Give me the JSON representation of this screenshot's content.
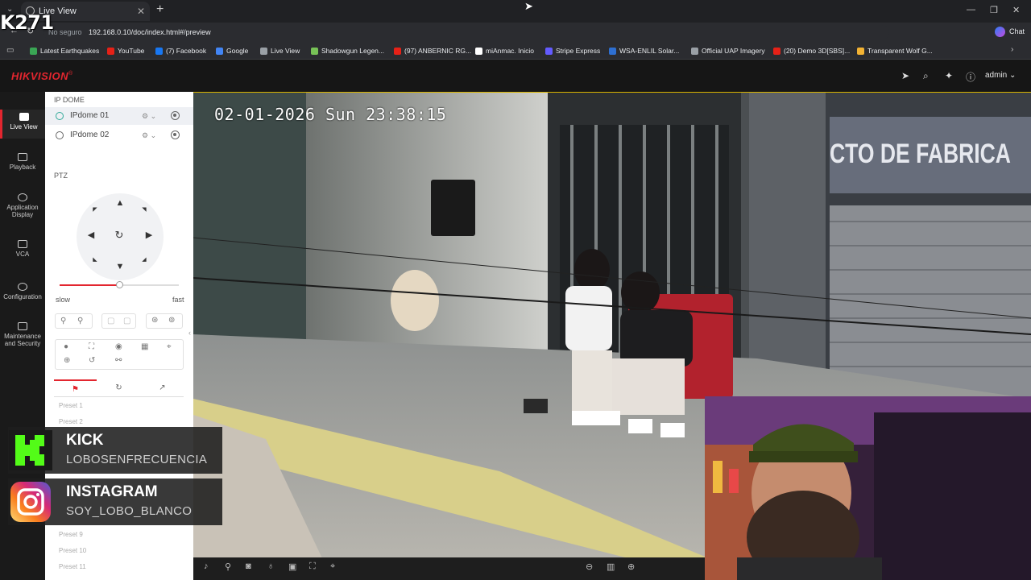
{
  "browser": {
    "tab_title": "Live View",
    "url_security": "No seguro",
    "url": "192.168.0.10/doc/index.html#/preview",
    "chat_label": "Chat",
    "bookmarks": [
      {
        "label": "Latest Earthquakes",
        "icon": "earthquake-icon",
        "color": "#3aa655"
      },
      {
        "label": "YouTube",
        "icon": "youtube-icon",
        "color": "#e62117"
      },
      {
        "label": "(7) Facebook",
        "icon": "facebook-icon",
        "color": "#1877f2"
      },
      {
        "label": "Google",
        "icon": "google-icon",
        "color": "#4285f4"
      },
      {
        "label": "Live View",
        "icon": "globe-icon",
        "color": "#9aa0a6"
      },
      {
        "label": "Shadowgun Legen...",
        "icon": "android-icon",
        "color": "#78c257"
      },
      {
        "label": "(97) ANBERNIC RG...",
        "icon": "youtube-icon",
        "color": "#e62117"
      },
      {
        "label": "miAnmac. Inicio",
        "icon": "r-icon",
        "color": "#ffffff"
      },
      {
        "label": "Stripe Express",
        "icon": "stripe-icon",
        "color": "#635bff"
      },
      {
        "label": "WSA-ENLIL Solar...",
        "icon": "noaa-icon",
        "color": "#2e6fd1"
      },
      {
        "label": "Official UAP Imagery",
        "icon": "globe-icon",
        "color": "#9aa0a6"
      },
      {
        "label": "(20) Demo 3D[SBS]...",
        "icon": "youtube-icon",
        "color": "#e62117"
      },
      {
        "label": "Transparent Wolf G...",
        "icon": "document-icon",
        "color": "#f2b233"
      }
    ]
  },
  "app": {
    "brand": "HIKVISION",
    "user": "admin",
    "nav": [
      {
        "label": "Live View",
        "icon": "live-view-icon"
      },
      {
        "label": "Playback",
        "icon": "playback-icon"
      },
      {
        "label": "Application Display",
        "icon": "application-icon"
      },
      {
        "label": "VCA",
        "icon": "vca-icon"
      },
      {
        "label": "Configuration",
        "icon": "gear-icon"
      },
      {
        "label": "Maintenance and Security",
        "icon": "maintenance-icon"
      }
    ],
    "device_group": "IP DOME",
    "devices": [
      "IPdome 01",
      "IPdome 02"
    ],
    "ptz_label": "PTZ",
    "speed_slow": "slow",
    "speed_fast": "fast",
    "speed_value": 0.5,
    "presets_visible": [
      "Preset 1",
      "Preset 2",
      "Preset 9",
      "Preset 10",
      "Preset 11"
    ]
  },
  "video": {
    "osd_timestamp": "02-01-2026 Sun 23:38:15",
    "sign_text": "CTO DE FABRICA"
  },
  "overlay": {
    "counter": "K271",
    "kick_title": "KICK",
    "kick_handle": "LOBOSENFRECUENCIA",
    "instagram_title": "INSTAGRAM",
    "instagram_handle": "SOY_LOBO_BLANCO"
  },
  "colors": {
    "brand_red": "#e3262f",
    "kick_green": "#53fc18",
    "active_border": "#d8b400"
  }
}
